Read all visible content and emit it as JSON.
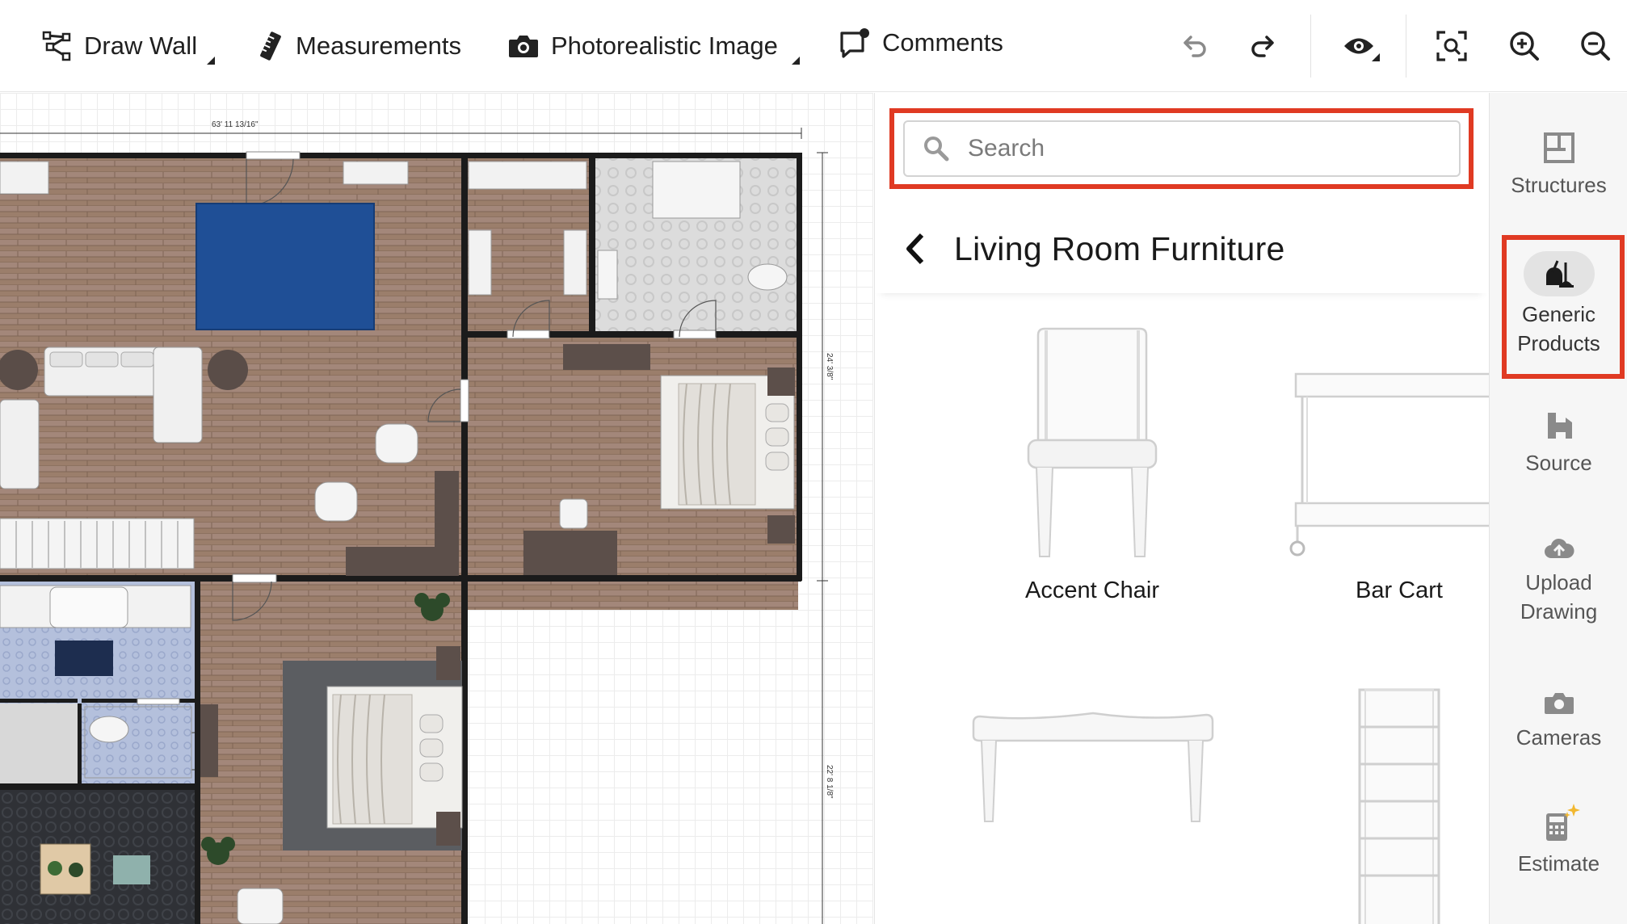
{
  "toolbar": {
    "draw_wall": "Draw Wall",
    "measurements": "Measurements",
    "photorealistic": "Photorealistic Image",
    "comments": "Comments",
    "icons": {
      "draw_wall": "wall-path-icon",
      "measurements": "ruler-icon",
      "photorealistic": "camera-icon",
      "comments": "comment-icon",
      "undo": "undo-icon",
      "redo": "redo-icon",
      "view": "eye-icon",
      "fit": "fit-screen-icon",
      "zoom_in": "zoom-in-icon",
      "zoom_out": "zoom-out-icon"
    }
  },
  "canvas": {
    "dim_top": "63' 11 13/16\"",
    "dim_right_upper": "24' 3/8\"",
    "dim_right_lower": "22' 8 1/8\""
  },
  "panel": {
    "search_placeholder": "Search",
    "category_title": "Living Room Furniture",
    "products": [
      {
        "name": "Accent Chair"
      },
      {
        "name": "Bar Cart"
      },
      {
        "name": ""
      },
      {
        "name": ""
      }
    ]
  },
  "nav": {
    "items": [
      {
        "label_1": "Structures",
        "label_2": ""
      },
      {
        "label_1": "Generic",
        "label_2": "Products"
      },
      {
        "label_1": "Source",
        "label_2": ""
      },
      {
        "label_1": "Upload",
        "label_2": "Drawing"
      },
      {
        "label_1": "Cameras",
        "label_2": ""
      },
      {
        "label_1": "Estimate",
        "label_2": ""
      }
    ],
    "active_index": 1
  },
  "colors": {
    "highlight": "#e03a23",
    "wall": "#1a1a1a",
    "wood_floor": "#9a7d6a",
    "rug_blue": "#1f4f96",
    "tile_floor": "#aebad7"
  }
}
